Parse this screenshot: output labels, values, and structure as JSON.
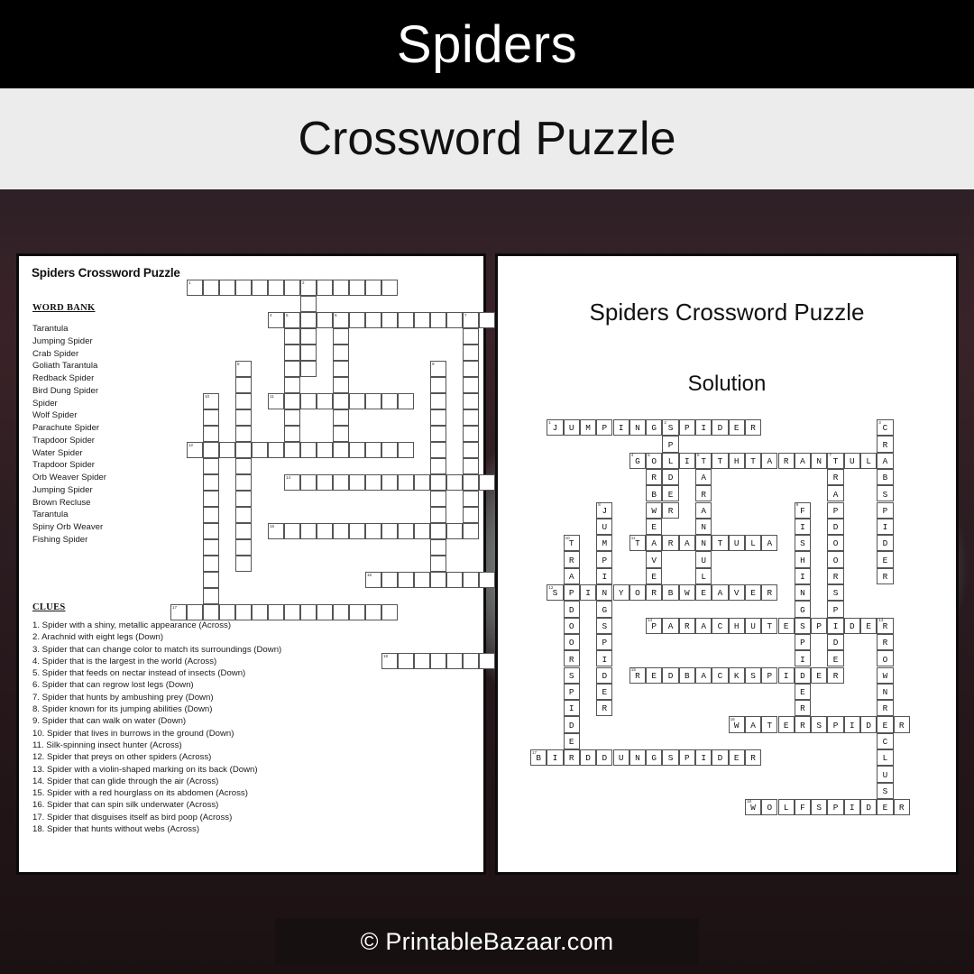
{
  "banner": {
    "title": "Spiders",
    "subtitle": "Crossword Puzzle"
  },
  "footer": {
    "text": "© PrintableBazaar.com"
  },
  "puzzle_sheet": {
    "title": "Spiders Crossword Puzzle",
    "word_bank_heading": "WORD BANK",
    "word_bank": [
      "Tarantula",
      "Jumping Spider",
      "Crab Spider",
      "Goliath Tarantula",
      "Redback Spider",
      "Bird Dung Spider",
      "Spider",
      "Wolf Spider",
      "Parachute Spider",
      "Trapdoor Spider",
      "Water Spider",
      "Trapdoor Spider",
      "Orb Weaver Spider",
      "Jumping Spider",
      "Brown Recluse",
      "Tarantula",
      "Spiny Orb Weaver",
      "Fishing Spider"
    ],
    "clues_heading": "CLUES",
    "clues": [
      "1. Spider with a shiny, metallic appearance (Across)",
      "2. Arachnid with eight legs (Down)",
      "3. Spider that can change color to match its surroundings (Down)",
      "4. Spider that is the largest in the world (Across)",
      "5. Spider that feeds on nectar instead of insects (Down)",
      "6. Spider that can regrow lost legs (Down)",
      "7. Spider that hunts by ambushing prey (Down)",
      "8. Spider known for its jumping abilities (Down)",
      "9. Spider that can walk on water (Down)",
      "10. Spider that lives in burrows in the ground (Down)",
      "11. Silk-spinning insect hunter (Across)",
      "12. Spider that preys on other spiders (Across)",
      "13. Spider with a violin-shaped marking on its back (Down)",
      "14. Spider that can glide through the air (Across)",
      "15. Spider with a red hourglass on its abdomen (Across)",
      "16. Spider that can spin silk underwater (Across)",
      "17. Spider that disguises itself as bird poop (Across)",
      "18. Spider that hunts without webs (Across)"
    ]
  },
  "solution_sheet": {
    "title": "Spiders Crossword Puzzle",
    "subtitle": "Solution"
  },
  "crossword": {
    "cell_size": 18.3,
    "entries": [
      {
        "number": 1,
        "answer": "JUMPINGSPIDER",
        "direction": "across",
        "row": 0,
        "col": 1,
        "clue_word": "Jumping Spider"
      },
      {
        "number": 2,
        "answer": "SPIDER",
        "direction": "down",
        "row": 0,
        "col": 8,
        "clue_word": "Spider"
      },
      {
        "number": 3,
        "answer": "CRABSPIDER",
        "direction": "down",
        "row": 0,
        "col": 21,
        "clue_word": "Crab Spider"
      },
      {
        "number": 4,
        "answer": "GOLIATHTARANTULA",
        "direction": "across",
        "row": 2,
        "col": 6,
        "clue_word": "Goliath Tarantula"
      },
      {
        "number": 5,
        "answer": "ORBWEAVER",
        "direction": "down",
        "row": 2,
        "col": 7,
        "clue_word": "Orb Weaver Spider"
      },
      {
        "number": 6,
        "answer": "TARANTULA",
        "direction": "down",
        "row": 2,
        "col": 10,
        "clue_word": "Tarantula"
      },
      {
        "number": 7,
        "answer": "TRAPDOORSPIDER",
        "direction": "down",
        "row": 2,
        "col": 18,
        "clue_word": "Trapdoor Spider"
      },
      {
        "number": 8,
        "answer": "JUMPINGSPIDER",
        "direction": "down",
        "row": 5,
        "col": 4,
        "clue_word": "Jumping Spider"
      },
      {
        "number": 9,
        "answer": "FISHINGSPIDER",
        "direction": "down",
        "row": 5,
        "col": 16,
        "clue_word": "Fishing Spider"
      },
      {
        "number": 10,
        "answer": "TRAPDOORSPIDER",
        "direction": "down",
        "row": 7,
        "col": 2,
        "clue_word": "Trapdoor Spider"
      },
      {
        "number": 11,
        "answer": "TARANTULA",
        "direction": "across",
        "row": 7,
        "col": 6,
        "clue_word": "Tarantula"
      },
      {
        "number": 12,
        "answer": "SPINYORBWEAVER",
        "direction": "across",
        "row": 10,
        "col": 1,
        "clue_word": "Spiny Orb Weaver"
      },
      {
        "number": 13,
        "answer": "BROWNRECLUSE",
        "direction": "down",
        "row": 12,
        "col": 21,
        "clue_word": "Brown Recluse"
      },
      {
        "number": 14,
        "answer": "PARACHUTESPIDER",
        "direction": "across",
        "row": 12,
        "col": 7,
        "clue_word": "Parachute Spider"
      },
      {
        "number": 15,
        "answer": "REDBACKSPIDER",
        "direction": "across",
        "row": 15,
        "col": 6,
        "clue_word": "Redback Spider"
      },
      {
        "number": 16,
        "answer": "WATERSPIDER",
        "direction": "across",
        "row": 18,
        "col": 12,
        "clue_word": "Water Spider"
      },
      {
        "number": 17,
        "answer": "BIRDDUNGSPIDER",
        "direction": "across",
        "row": 20,
        "col": 0,
        "clue_word": "Bird Dung Spider"
      },
      {
        "number": 18,
        "answer": "WOLFSPIDER",
        "direction": "across",
        "row": 23,
        "col": 13,
        "clue_word": "Wolf Spider"
      }
    ]
  },
  "colors": {
    "banner_bg": "#000000",
    "banner_text": "#ffffff",
    "subbanner_bg": "#ececec",
    "sheet_bg": "#ffffff",
    "sheet_border": "#0b0b0b",
    "cell_border": "#555555",
    "text": "#111111"
  }
}
